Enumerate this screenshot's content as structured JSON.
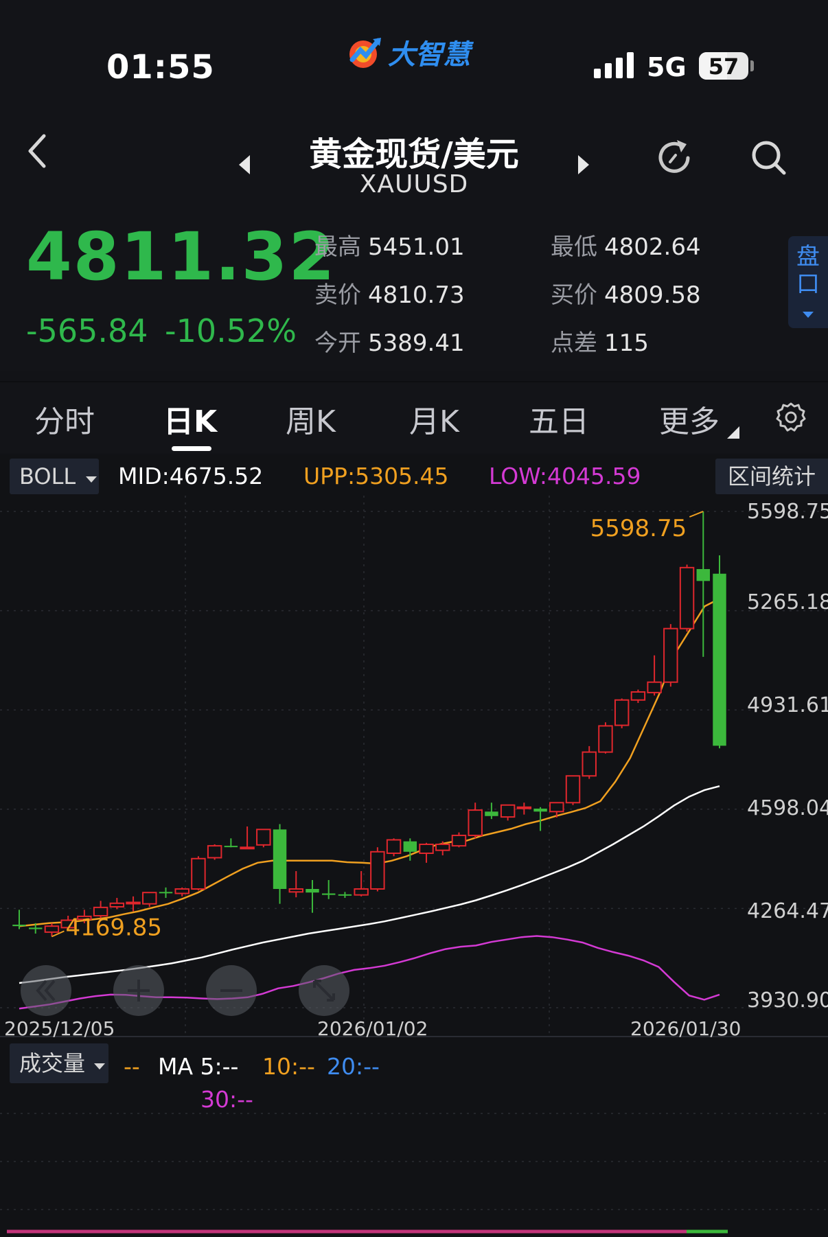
{
  "status_bar": {
    "time": "01:55",
    "network": "5G",
    "battery": "57",
    "battery_level": 0.57
  },
  "app": {
    "logo_text": "大智慧"
  },
  "header": {
    "title": "黄金现货/美元",
    "symbol": "XAUUSD"
  },
  "quote": {
    "price": "4811.32",
    "change": "-565.84",
    "change_pct": "-10.52%",
    "high_label": "最高",
    "high": "5451.01",
    "low_label": "最低",
    "low": "4802.64",
    "ask_label": "卖价",
    "ask": "4810.73",
    "bid_label": "买价",
    "bid": "4809.58",
    "open_label": "今开",
    "open": "5389.41",
    "spread_label": "点差",
    "spread": "115",
    "pankou": "盘口"
  },
  "tabs": [
    "分时",
    "日K",
    "周K",
    "月K",
    "五日",
    "更多"
  ],
  "indicator": {
    "name": "BOLL",
    "mid": "MID:4675.52",
    "upp": "UPP:5305.45",
    "low": "LOW:4045.59",
    "range_stats": "区间统计"
  },
  "colors": {
    "up": "#e0272d",
    "down": "#3cb83c",
    "mid": "#ffffff",
    "upp": "#f0a020",
    "low": "#d43ad4",
    "price": "#2fb84c",
    "accent": "#3f8cf0"
  },
  "chart_data": {
    "type": "candlestick",
    "y_ticks": [
      "5598.75",
      "5265.18",
      "4931.61",
      "4598.04",
      "4264.47",
      "3930.90"
    ],
    "ylim": [
      3930.9,
      5598.75
    ],
    "x_labels": [
      "2025/12/05",
      "2026/01/02",
      "2026/01/30"
    ],
    "max_label": "5598.75",
    "min_label": "4169.85",
    "candles": [
      {
        "o": 4210,
        "h": 4260,
        "l": 4195,
        "c": 4205
      },
      {
        "o": 4200,
        "h": 4215,
        "l": 4180,
        "c": 4195
      },
      {
        "o": 4185,
        "h": 4215,
        "l": 4170,
        "c": 4205
      },
      {
        "o": 4200,
        "h": 4240,
        "l": 4190,
        "c": 4225
      },
      {
        "o": 4228,
        "h": 4260,
        "l": 4215,
        "c": 4238
      },
      {
        "o": 4240,
        "h": 4290,
        "l": 4232,
        "c": 4268
      },
      {
        "o": 4270,
        "h": 4300,
        "l": 4262,
        "c": 4282
      },
      {
        "o": 4282,
        "h": 4305,
        "l": 4255,
        "c": 4285
      },
      {
        "o": 4280,
        "h": 4315,
        "l": 4270,
        "c": 4318
      },
      {
        "o": 4320,
        "h": 4335,
        "l": 4300,
        "c": 4318
      },
      {
        "o": 4315,
        "h": 4335,
        "l": 4305,
        "c": 4330
      },
      {
        "o": 4330,
        "h": 4440,
        "l": 4325,
        "c": 4432
      },
      {
        "o": 4435,
        "h": 4480,
        "l": 4428,
        "c": 4475
      },
      {
        "o": 4475,
        "h": 4500,
        "l": 4470,
        "c": 4472
      },
      {
        "o": 4470,
        "h": 4540,
        "l": 4466,
        "c": 4470
      },
      {
        "o": 4478,
        "h": 4530,
        "l": 4470,
        "c": 4530
      },
      {
        "o": 4530,
        "h": 4548,
        "l": 4280,
        "c": 4330
      },
      {
        "o": 4320,
        "h": 4390,
        "l": 4302,
        "c": 4330
      },
      {
        "o": 4330,
        "h": 4360,
        "l": 4250,
        "c": 4318
      },
      {
        "o": 4315,
        "h": 4360,
        "l": 4296,
        "c": 4310
      },
      {
        "o": 4312,
        "h": 4320,
        "l": 4300,
        "c": 4308
      },
      {
        "o": 4310,
        "h": 4390,
        "l": 4305,
        "c": 4330
      },
      {
        "o": 4330,
        "h": 4470,
        "l": 4322,
        "c": 4455
      },
      {
        "o": 4450,
        "h": 4500,
        "l": 4440,
        "c": 4495
      },
      {
        "o": 4490,
        "h": 4500,
        "l": 4425,
        "c": 4455
      },
      {
        "o": 4450,
        "h": 4485,
        "l": 4418,
        "c": 4480
      },
      {
        "o": 4460,
        "h": 4490,
        "l": 4443,
        "c": 4480
      },
      {
        "o": 4475,
        "h": 4520,
        "l": 4470,
        "c": 4510
      },
      {
        "o": 4510,
        "h": 4620,
        "l": 4500,
        "c": 4595
      },
      {
        "o": 4590,
        "h": 4620,
        "l": 4565,
        "c": 4575
      },
      {
        "o": 4572,
        "h": 4610,
        "l": 4560,
        "c": 4612
      },
      {
        "o": 4605,
        "h": 4620,
        "l": 4580,
        "c": 4605
      },
      {
        "o": 4600,
        "h": 4605,
        "l": 4525,
        "c": 4590
      },
      {
        "o": 4590,
        "h": 4620,
        "l": 4570,
        "c": 4620
      },
      {
        "o": 4620,
        "h": 4710,
        "l": 4612,
        "c": 4710
      },
      {
        "o": 4710,
        "h": 4810,
        "l": 4700,
        "c": 4790
      },
      {
        "o": 4790,
        "h": 4890,
        "l": 4785,
        "c": 4878
      },
      {
        "o": 4880,
        "h": 4970,
        "l": 4870,
        "c": 4965
      },
      {
        "o": 4965,
        "h": 5000,
        "l": 4955,
        "c": 4992
      },
      {
        "o": 4990,
        "h": 5115,
        "l": 4980,
        "c": 5025
      },
      {
        "o": 5025,
        "h": 5220,
        "l": 5010,
        "c": 5205
      },
      {
        "o": 5205,
        "h": 5420,
        "l": 5195,
        "c": 5410
      },
      {
        "o": 5405,
        "h": 5598.75,
        "l": 5110,
        "c": 5365
      },
      {
        "o": 5389.41,
        "h": 5451.01,
        "l": 4802.64,
        "c": 4811.32
      }
    ],
    "series": [
      {
        "name": "UPP",
        "values": [
          4205,
          4210,
          4215,
          4218,
          4222,
          4228,
          4234,
          4245,
          4255,
          4268,
          4280,
          4298,
          4318,
          4345,
          4372,
          4398,
          4418,
          4425,
          4425,
          4425,
          4425,
          4425,
          4420,
          4418,
          4415,
          4425,
          4440,
          4460,
          4478,
          4488,
          4492,
          4508,
          4520,
          4532,
          4548,
          4560,
          4575,
          4588,
          4602,
          4625,
          4690,
          4770,
          4880,
          4990,
          5120,
          5200,
          5280,
          5305.45
        ]
      },
      {
        "name": "MID",
        "values": [
          4014,
          4020,
          4027,
          4034,
          4040,
          4046,
          4052,
          4058,
          4065,
          4072,
          4080,
          4090,
          4100,
          4113,
          4126,
          4138,
          4150,
          4160,
          4170,
          4180,
          4188,
          4196,
          4204,
          4212,
          4221,
          4232,
          4243,
          4254,
          4266,
          4278,
          4292,
          4308,
          4325,
          4343,
          4362,
          4382,
          4402,
          4424,
          4452,
          4480,
          4510,
          4540,
          4574,
          4610,
          4640,
          4662,
          4675.52
        ]
      },
      {
        "name": "LOW",
        "values": [
          3928,
          3935,
          3942,
          3952,
          3962,
          3970,
          3975,
          3974,
          3970,
          3966,
          3966,
          3965,
          3962,
          3960,
          3962,
          3966,
          3978,
          3996,
          4004,
          4016,
          4030,
          4046,
          4058,
          4064,
          4072,
          4084,
          4098,
          4114,
          4128,
          4136,
          4140,
          4152,
          4160,
          4168,
          4172,
          4168,
          4160,
          4150,
          4132,
          4118,
          4106,
          4090,
          4068,
          4018,
          3972,
          3958,
          3975
        ]
      }
    ]
  },
  "chart_controls": [
    "rewind",
    "zoom-in",
    "zoom-out",
    "fullscreen"
  ],
  "volume": {
    "name": "成交量",
    "dash": "--",
    "ma5": "MA 5:--",
    "ma10": "10:--",
    "ma20": "20:--",
    "ma30": "30:--"
  }
}
